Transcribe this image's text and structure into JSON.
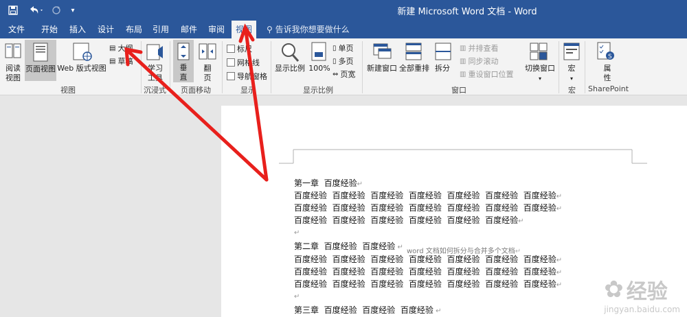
{
  "window": {
    "title": "新建 Microsoft Word 文档  -  Word",
    "qat": {
      "save_icon": "save-icon",
      "undo_icon": "undo-icon",
      "redo_icon": "redo-icon",
      "more": "customize-icon"
    }
  },
  "tabs": [
    {
      "label": "文件"
    },
    {
      "label": "开始"
    },
    {
      "label": "插入"
    },
    {
      "label": "设计"
    },
    {
      "label": "布局"
    },
    {
      "label": "引用"
    },
    {
      "label": "邮件"
    },
    {
      "label": "审阅"
    },
    {
      "label": "视图",
      "active": true
    }
  ],
  "tellme": "告诉我你想要做什么",
  "ribbon": {
    "views": {
      "read_mode": "阅读\n视图",
      "print_layout": "页面视图",
      "web_layout": "Web 版式视图",
      "outline": "大纲",
      "draft": "草稿",
      "group": "视图"
    },
    "immersive": {
      "learning_tools": "学习\n工具",
      "group": "沉浸式"
    },
    "page_movement": {
      "vertical": "垂\n直",
      "side_to_side": "翻\n页",
      "group": "页面移动"
    },
    "show": {
      "ruler": "标尺",
      "gridlines": "网格线",
      "nav_pane": "导航窗格",
      "group": "显示"
    },
    "zoom": {
      "zoom": "显示比例",
      "percent": "100%",
      "one_page": "单页",
      "multiple_pages": "多页",
      "page_width": "页宽",
      "group": "显示比例"
    },
    "window": {
      "new_window": "新建窗口",
      "arrange_all": "全部重排",
      "split": "拆分",
      "side_by_side": "并排查看",
      "sync_scroll": "同步滚动",
      "reset_position": "重设窗口位置",
      "switch_windows": "切换窗口",
      "group": "窗口"
    },
    "macros": {
      "macros": "宏",
      "group": "宏"
    },
    "sharepoint": {
      "properties": "属\n性",
      "group": "SharePoint"
    }
  },
  "document": {
    "header": "word 文档如何拆分与合并多个文档",
    "lines": [
      "第一章  百度经验",
      "百度经验  百度经验  百度经验  百度经验  百度经验  百度经验  百度经验",
      "百度经验  百度经验  百度经验  百度经验  百度经验  百度经验  百度经验",
      "百度经验  百度经验  百度经验  百度经验  百度经验  百度经验",
      "",
      "第二章  百度经验  百度经验",
      "百度经验  百度经验  百度经验  百度经验  百度经验  百度经验  百度经验",
      "百度经验  百度经验  百度经验  百度经验  百度经验  百度经验  百度经验",
      "百度经验  百度经验  百度经验  百度经验  百度经验  百度经验  百度经验",
      "",
      "第三章  百度经验  百度经验  百度经验"
    ]
  },
  "watermark": {
    "brand": "经验",
    "url": "jingyan.baidu.com"
  },
  "colors": {
    "word_blue": "#2b579a",
    "annotation_red": "#e8201c",
    "ribbon_bg": "#f3f3f3"
  }
}
